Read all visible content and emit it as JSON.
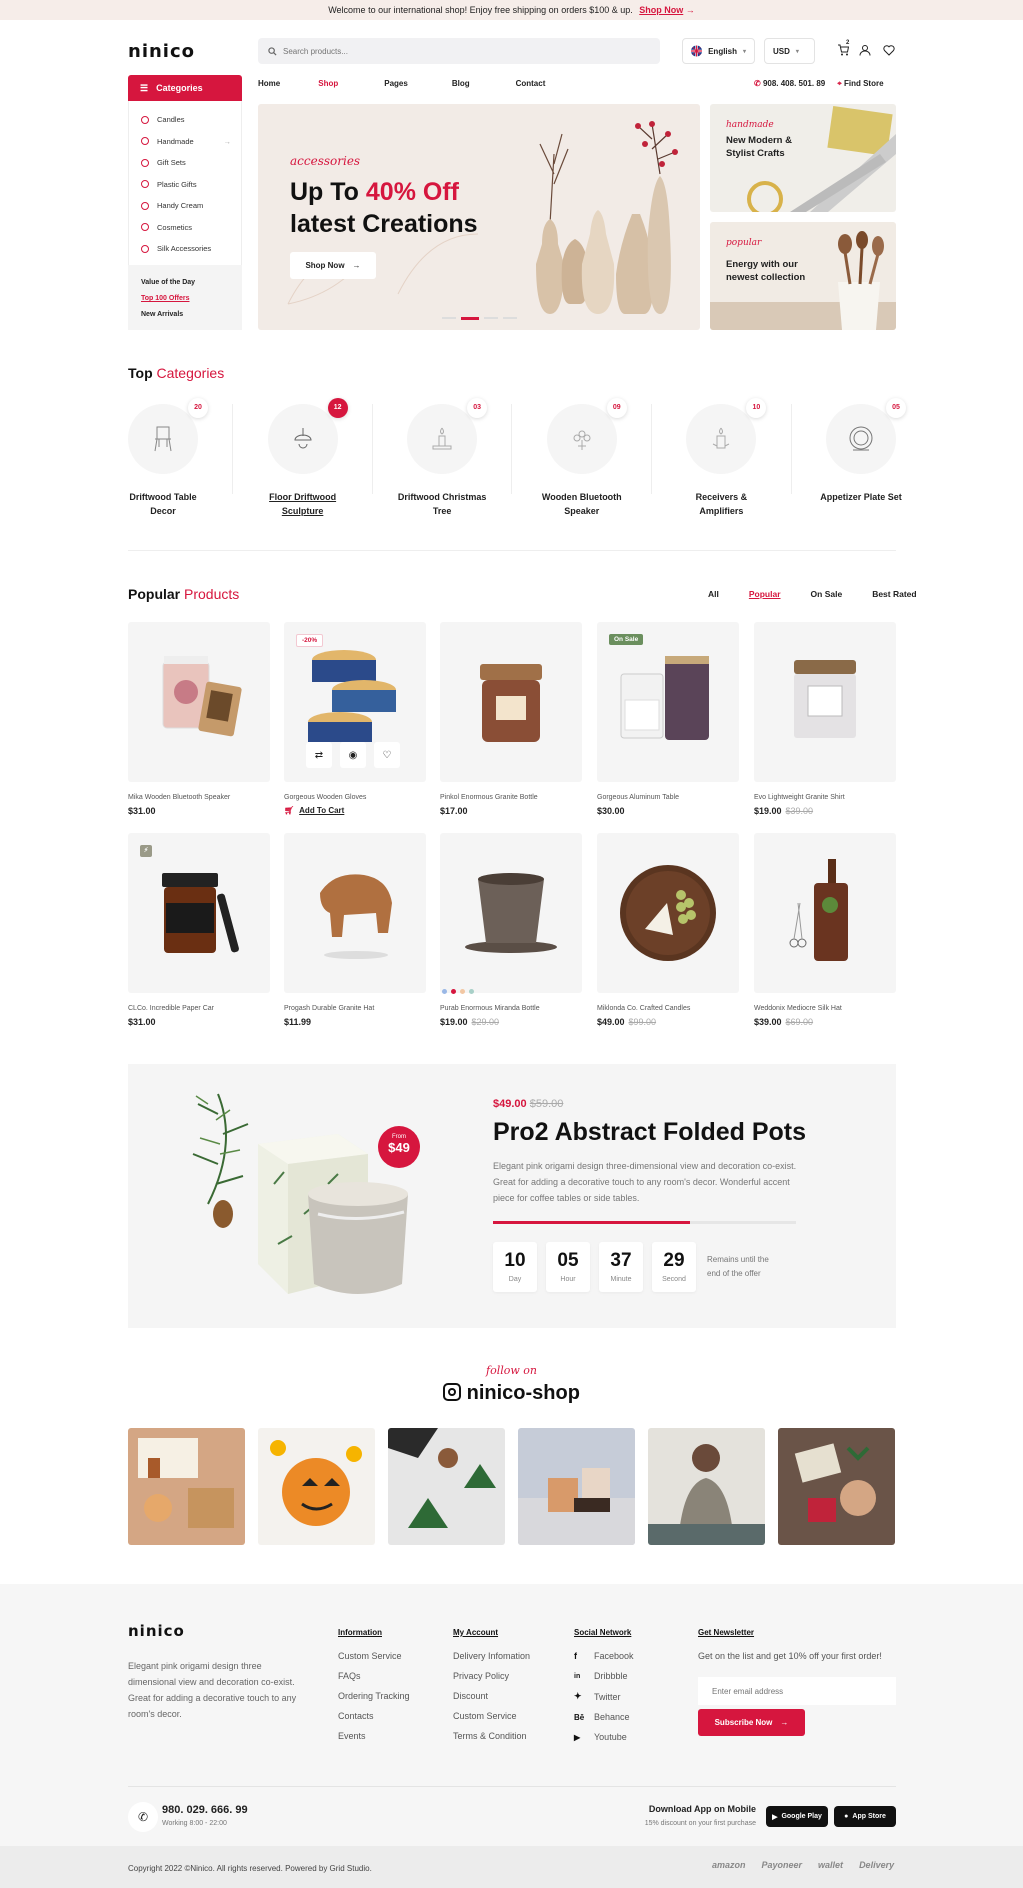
{
  "announcement": {
    "text": "Welcome to our international shop! Enjoy free shipping on orders $100 & up.",
    "link": "Shop Now"
  },
  "header": {
    "logo": "ninico",
    "search_placeholder": "Search products...",
    "language": "English",
    "currency": "USD",
    "cart_count": "2"
  },
  "nav": {
    "items": [
      "Home",
      "Shop",
      "Pages",
      "Blog",
      "Contact"
    ],
    "phone": "908. 408. 501. 89",
    "find_store": "Find Store"
  },
  "categories": {
    "button": "Categories",
    "items": [
      "Candles",
      "Handmade",
      "Gift Sets",
      "Plastic Gifts",
      "Handy Cream",
      "Cosmetics",
      "Silk Accessories"
    ],
    "extras": [
      "Value of the Day",
      "Top 100 Offers",
      "New Arrivals"
    ]
  },
  "hero": {
    "script": "accessories",
    "line1": "Up To ",
    "highlight": "40% Off",
    "line2": "latest Creations",
    "button": "Shop Now"
  },
  "side_banners": [
    {
      "script": "handmade",
      "title": "New Modern & Stylist Crafts"
    },
    {
      "script": "popular",
      "title": "Energy with our newest collection"
    }
  ],
  "top_categories": {
    "title": "Top",
    "title_accent": "Categories",
    "items": [
      {
        "count": "20",
        "name": "Driftwood Table Decor",
        "icon": "chair-icon"
      },
      {
        "count": "12",
        "name": "Floor Driftwood Sculpture",
        "icon": "lamp-icon"
      },
      {
        "count": "03",
        "name": "Driftwood Christmas Tree",
        "icon": "candle-icon"
      },
      {
        "count": "09",
        "name": "Wooden Bluetooth Speaker",
        "icon": "flower-icon"
      },
      {
        "count": "10",
        "name": "Receivers & Amplifiers",
        "icon": "candle-icon"
      },
      {
        "count": "05",
        "name": "Appetizer Plate Set",
        "icon": "plate-icon"
      }
    ]
  },
  "popular": {
    "title": "Popular",
    "title_accent": "Products",
    "tabs": [
      "All",
      "Popular",
      "On Sale",
      "Best Rated"
    ],
    "products": [
      {
        "name": "Mika Wooden Bluetooth Speaker",
        "price": "$31.00",
        "old": ""
      },
      {
        "name": "Gorgeous Wooden Gloves",
        "price": "",
        "old": "",
        "tag": "-20%",
        "add_to_cart": "Add To Cart"
      },
      {
        "name": "Pinkol Enormous Granite Bottle",
        "price": "$17.00",
        "old": ""
      },
      {
        "name": "Gorgeous Aluminum Table",
        "price": "$30.00",
        "old": "",
        "tag": "On Sale"
      },
      {
        "name": "Evo Lightweight Granite Shirt",
        "price": "$19.00",
        "old": "$39.00"
      },
      {
        "name": "CLCo. Incredible Paper Car",
        "price": "$31.00",
        "old": ""
      },
      {
        "name": "Progash Durable Granite Hat",
        "price": "$11.99",
        "old": ""
      },
      {
        "name": "Purab Enormous Miranda Bottle",
        "price": "$19.00",
        "old": "$29.00"
      },
      {
        "name": "Miklonda Co. Crafted Candles",
        "price": "$49.00",
        "old": "$99.00"
      },
      {
        "name": "Weddonix Mediocre Silk Hat",
        "price": "$39.00",
        "old": "$69.00"
      }
    ]
  },
  "deal": {
    "badge_from": "From",
    "badge_price": "$49",
    "price": "$49.00",
    "old_price": "$59.00",
    "title": "Pro2 Abstract Folded Pots",
    "desc": "Elegant pink origami design three-dimensional view and decoration co-exist. Great for adding a decorative touch to any room's decor. Wonderful accent piece for coffee tables or side tables.",
    "progress": 0.65,
    "countdown": [
      {
        "v": "10",
        "l": "Day"
      },
      {
        "v": "05",
        "l": "Hour"
      },
      {
        "v": "37",
        "l": "Minute"
      },
      {
        "v": "29",
        "l": "Second"
      }
    ],
    "remains": "Remains until the end of the offer"
  },
  "instagram": {
    "script": "follow on",
    "handle": "ninico-shop"
  },
  "footer": {
    "logo": "ninico",
    "about": "Elegant pink origami design three dimensional view and decoration co-exist. Great for adding a decorative touch to any room's decor.",
    "info_title": "Information",
    "info": [
      "Custom Service",
      "FAQs",
      "Ordering Tracking",
      "Contacts",
      "Events"
    ],
    "account_title": "My Account",
    "account": [
      "Delivery Infomation",
      "Privacy Policy",
      "Discount",
      "Custom Service",
      "Terms & Condition"
    ],
    "social_title": "Social Network",
    "social": [
      "Facebook",
      "Dribbble",
      "Twitter",
      "Behance",
      "Youtube"
    ],
    "news_title": "Get Newsletter",
    "news_text": "Get on the list and get 10% off your first order!",
    "email_placeholder": "Enter email address",
    "subscribe": "Subscribe Now",
    "phone": "980. 029. 666. 99",
    "hours": "Working 8:00 - 22:00",
    "app_title": "Download App on Mobile",
    "app_sub": "15% discount on your first purchase",
    "google": "Google Play",
    "apple": "App Store",
    "copyright": "Copyright 2022 ©Ninico. All rights reserved. Powered by Grid Studio.",
    "partners": [
      "amazon",
      "Payoneer",
      "wallet",
      "Delivery"
    ]
  },
  "colors": {
    "accent": "#d6163e",
    "green": "#6b8f5e"
  }
}
